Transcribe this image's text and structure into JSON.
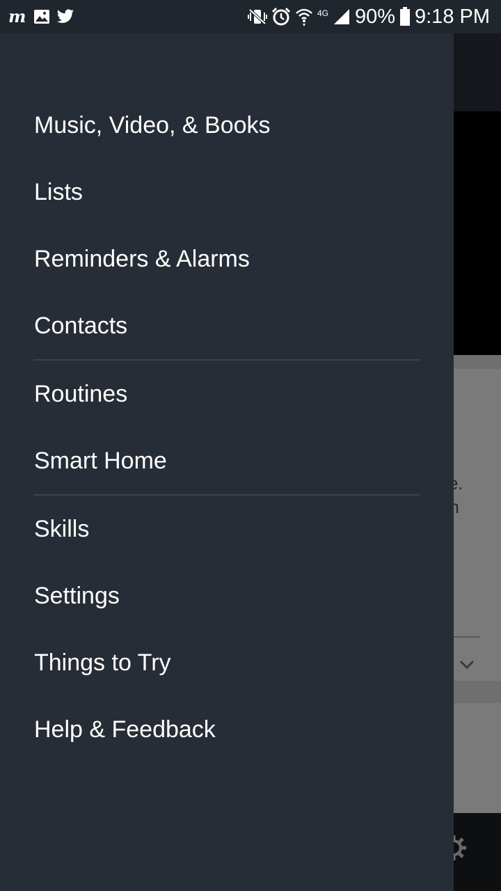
{
  "status_bar": {
    "battery_percent": "90%",
    "time": "9:18 PM",
    "network": "4G",
    "left_icons": [
      "m-app-icon",
      "gallery-icon",
      "twitter-icon"
    ],
    "right_icons": [
      "vibrate-mute-icon",
      "alarm-icon",
      "wifi-icon",
      "signal-icon",
      "battery-icon"
    ]
  },
  "drawer": {
    "groups": [
      {
        "items": [
          {
            "label": "Music, Video, & Books"
          },
          {
            "label": "Lists"
          },
          {
            "label": "Reminders & Alarms"
          },
          {
            "label": "Contacts"
          }
        ]
      },
      {
        "items": [
          {
            "label": "Routines"
          },
          {
            "label": "Smart Home"
          }
        ]
      },
      {
        "items": [
          {
            "label": "Skills"
          },
          {
            "label": "Settings"
          },
          {
            "label": "Things to Try"
          },
          {
            "label": "Help & Feedback"
          }
        ]
      }
    ]
  },
  "background": {
    "card_text_fragments": "ce.\non\nw\ne."
  },
  "colors": {
    "drawer_bg": "#272d37",
    "status_bar_bg": "#20262d",
    "menu_text": "#ffffff",
    "divider": "#3b424c"
  }
}
